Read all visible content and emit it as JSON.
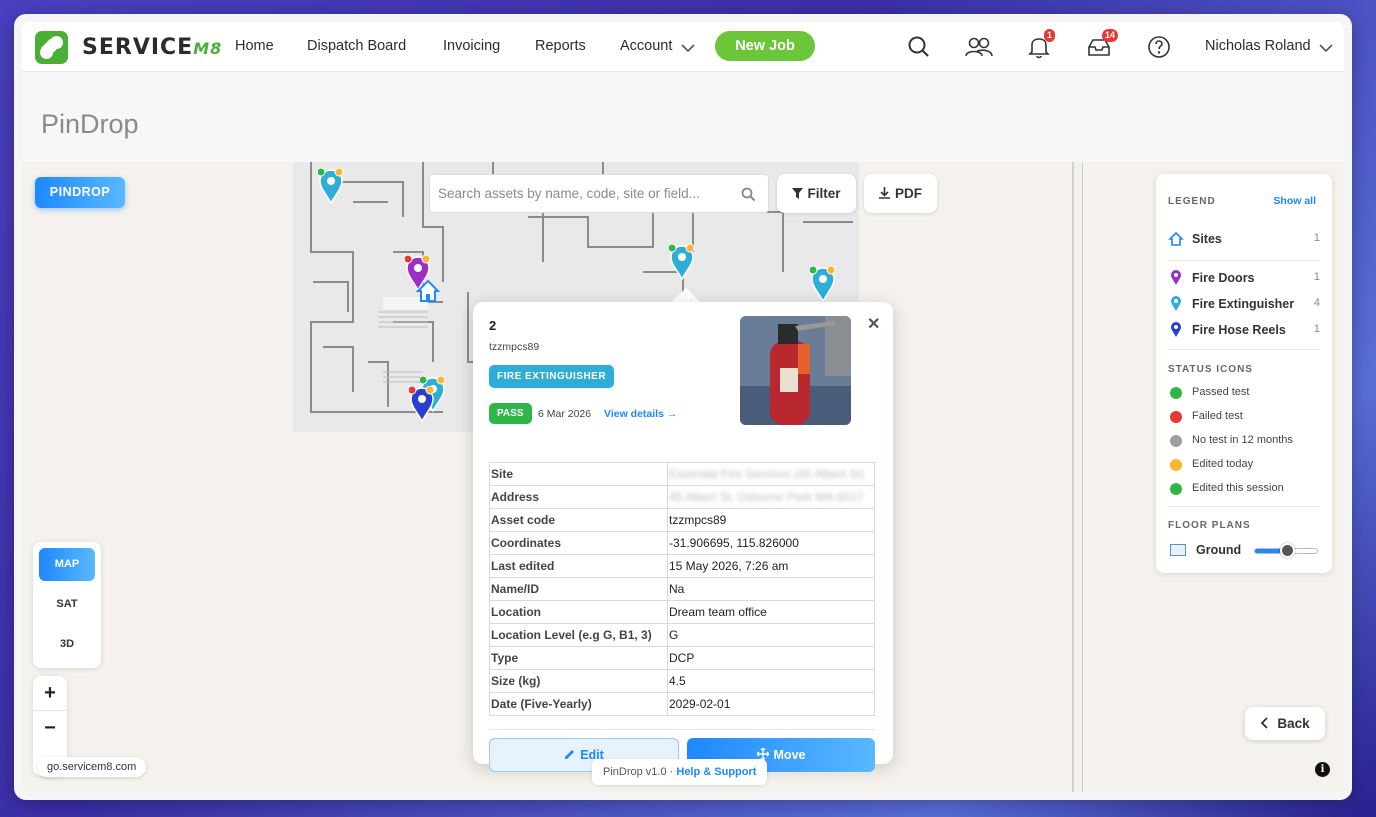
{
  "app": {
    "brand": "SERVICE",
    "brand_suffix": "M8",
    "nav": [
      "Home",
      "Dispatch Board",
      "Invoicing",
      "Reports",
      "Account"
    ],
    "new_job": "New Job",
    "notifications_count": "1",
    "inbox_count": "14",
    "user_name": "Nicholas Roland"
  },
  "page": {
    "title": "PinDrop"
  },
  "toolbar": {
    "pindrop_label": "PINDROP",
    "search_placeholder": "Search assets by name, code, site or field...",
    "filter_label": "Filter",
    "pdf_label": "PDF"
  },
  "legend": {
    "title": "LEGEND",
    "show_all": "Show all",
    "categories": [
      {
        "label": "Sites",
        "count": "1",
        "color": "#1e88ff",
        "icon": "home-icon"
      },
      {
        "label": "Fire Doors",
        "count": "1",
        "color": "#9b2fc8",
        "icon": "pin-icon"
      },
      {
        "label": "Fire Extinguisher",
        "count": "4",
        "color": "#2eaed6",
        "icon": "pin-icon"
      },
      {
        "label": "Fire Hose Reels",
        "count": "1",
        "color": "#2a3fcf",
        "icon": "pin-icon"
      }
    ],
    "status_title": "STATUS ICONS",
    "statuses": [
      {
        "label": "Passed test",
        "color": "#2fb64a",
        "icon": "check-icon"
      },
      {
        "label": "Failed test",
        "color": "#e53935",
        "icon": "cross-icon"
      },
      {
        "label": "No test in 12 months",
        "color": "#9e9e9e",
        "icon": "question-icon"
      },
      {
        "label": "Edited today",
        "color": "#f5b82e",
        "icon": "dot-icon"
      },
      {
        "label": "Edited this session",
        "color": "#2fb64a",
        "icon": "dot-icon"
      }
    ],
    "floor_title": "FLOOR PLANS",
    "floor_label": "Ground"
  },
  "map_modes": [
    "MAP",
    "SAT",
    "3D"
  ],
  "active_mode": "MAP",
  "zoom": {
    "in": "+",
    "out": "−"
  },
  "url_chip": "go.servicem8.com",
  "version": {
    "text": "PinDrop v1.0 · ",
    "link": "Help & Support"
  },
  "back_label": "Back",
  "popup": {
    "number": "2",
    "code": "tzzmpcs89",
    "type_badge": "FIRE EXTINGUISHER",
    "status_badge": "PASS",
    "status_date": "6 Mar 2026",
    "view_details": "View details →",
    "rows": [
      {
        "k": "Site",
        "v": "Essential Fire Services (45 Albert St)",
        "blur": true
      },
      {
        "k": "Address",
        "v": "45 Albert St, Osborne Park WA 6017",
        "blur": true
      },
      {
        "k": "Asset code",
        "v": "tzzmpcs89",
        "blur": false
      },
      {
        "k": "Coordinates",
        "v": "-31.906695, 115.826000",
        "blur": false
      },
      {
        "k": "Last edited",
        "v": "15 May 2026, 7:26 am",
        "blur": false
      },
      {
        "k": "Name/ID",
        "v": "Na",
        "blur": false
      },
      {
        "k": "Location",
        "v": "Dream team office",
        "blur": false
      },
      {
        "k": "Location Level (e.g G, B1, 3)",
        "v": "G",
        "blur": false
      },
      {
        "k": "Type",
        "v": "DCP",
        "blur": false
      },
      {
        "k": "Size (kg)",
        "v": "4.5",
        "blur": false
      },
      {
        "k": "Date (Five-Yearly)",
        "v": "2029-02-01",
        "blur": false
      }
    ],
    "edit_label": "Edit",
    "move_label": "Move"
  }
}
